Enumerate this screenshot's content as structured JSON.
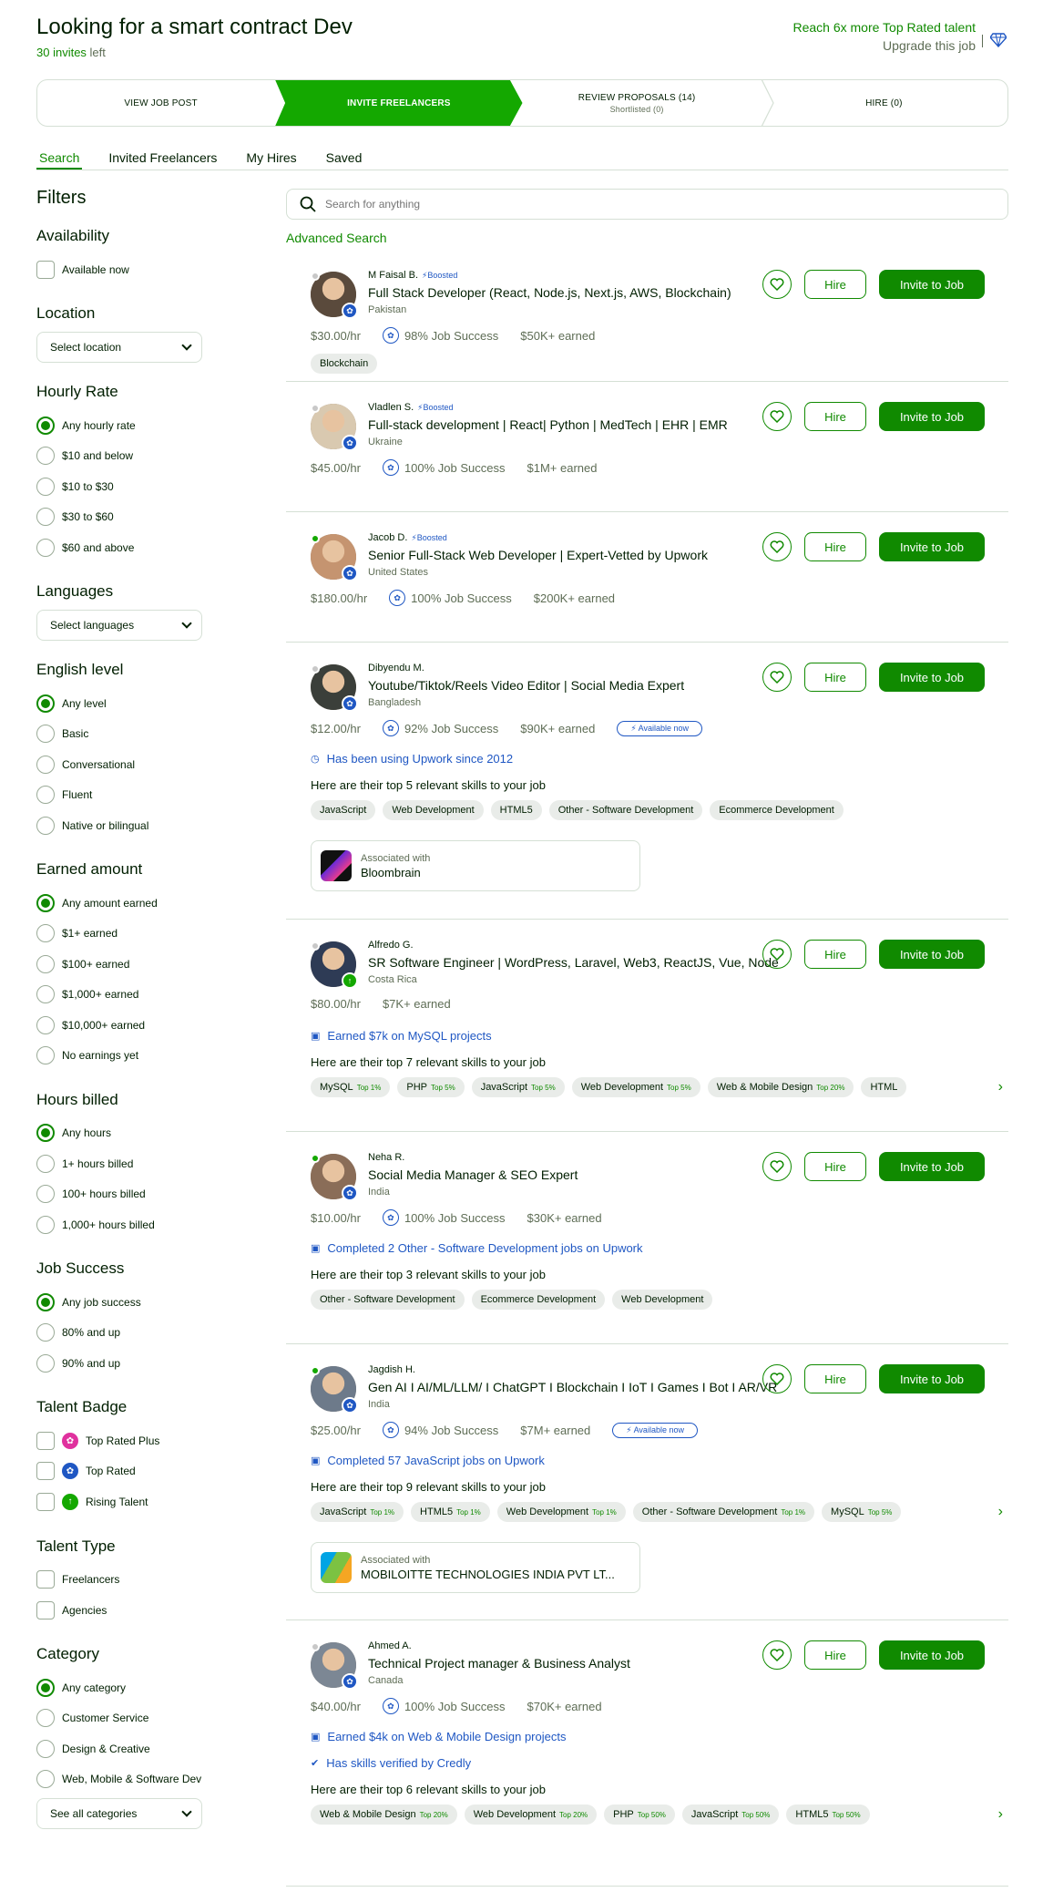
{
  "header": {
    "title": "Looking for a smart contract Dev",
    "invites_count": "30 invites",
    "invites_suffix": " left",
    "reach_text": "Reach 6x more Top Rated talent",
    "upgrade_text": "Upgrade this job"
  },
  "steps": [
    {
      "label": "VIEW JOB POST",
      "sub": ""
    },
    {
      "label": "INVITE FREELANCERS",
      "sub": ""
    },
    {
      "label": "REVIEW PROPOSALS (14)",
      "sub": "Shortlisted (0)"
    },
    {
      "label": "HIRE (0)",
      "sub": ""
    }
  ],
  "tabs": [
    "Search",
    "Invited Freelancers",
    "My Hires",
    "Saved"
  ],
  "filters": {
    "title": "Filters",
    "availability": {
      "title": "Availability",
      "options": [
        "Available now"
      ]
    },
    "location": {
      "title": "Location",
      "placeholder": "Select location"
    },
    "hourly_rate": {
      "title": "Hourly Rate",
      "options": [
        "Any hourly rate",
        "$10 and below",
        "$10 to $30",
        "$30 to $60",
        "$60 and above"
      ],
      "selected": 0
    },
    "languages": {
      "title": "Languages",
      "placeholder": "Select languages"
    },
    "english": {
      "title": "English level",
      "options": [
        "Any level",
        "Basic",
        "Conversational",
        "Fluent",
        "Native or bilingual"
      ],
      "selected": 0
    },
    "earned": {
      "title": "Earned amount",
      "options": [
        "Any amount earned",
        "$1+ earned",
        "$100+ earned",
        "$1,000+ earned",
        "$10,000+ earned",
        "No earnings yet"
      ],
      "selected": 0
    },
    "hours": {
      "title": "Hours billed",
      "options": [
        "Any hours",
        "1+ hours billed",
        "100+ hours billed",
        "1,000+ hours billed"
      ],
      "selected": 0
    },
    "job_success": {
      "title": "Job Success",
      "options": [
        "Any job success",
        "80% and up",
        "90% and up"
      ],
      "selected": 0
    },
    "badge": {
      "title": "Talent Badge",
      "options": [
        "Top Rated Plus",
        "Top Rated",
        "Rising Talent"
      ]
    },
    "type": {
      "title": "Talent Type",
      "options": [
        "Freelancers",
        "Agencies"
      ]
    },
    "category": {
      "title": "Category",
      "options": [
        "Any category",
        "Customer Service",
        "Design & Creative",
        "Web, Mobile & Software Dev"
      ],
      "selected": 0,
      "see_all": "See all categories"
    }
  },
  "search": {
    "placeholder": "Search for anything",
    "advanced": "Advanced Search"
  },
  "actions": {
    "hire": "Hire",
    "invite": "Invite to Job"
  },
  "boosted": "Boosted",
  "available_now": "Available now",
  "associated_with": "Associated with",
  "colors": {
    "primary": "#108a00",
    "brand_green": "#14a800",
    "link_blue": "#1f57c3",
    "muted": "#5e6d55"
  },
  "freelancers": [
    {
      "name": "M Faisal B.",
      "boosted": true,
      "headline": "Full Stack Developer (React, Node.js, Next.js, AWS, Blockchain)",
      "country": "Pakistan",
      "rate": "$30.00/hr",
      "job_success": "98% Job Success",
      "earned": "$50K+ earned",
      "badge": "top-rated",
      "online": false,
      "skills": [
        {
          "name": "Blockchain"
        }
      ]
    },
    {
      "name": "Vladlen S.",
      "boosted": true,
      "headline": "Full-stack development | React| Python | MedTech | EHR | EMR",
      "country": "Ukraine",
      "rate": "$45.00/hr",
      "job_success": "100% Job Success",
      "earned": "$1M+ earned",
      "badge": "top-rated",
      "online": false
    },
    {
      "name": "Jacob D.",
      "boosted": true,
      "headline": "Senior Full-Stack Web Developer | Expert-Vetted by Upwork",
      "country": "United States",
      "rate": "$180.00/hr",
      "job_success": "100% Job Success",
      "earned": "$200K+ earned",
      "badge": "top-rated",
      "online": true
    },
    {
      "name": "Dibyendu M.",
      "boosted": false,
      "headline": "Youtube/Tiktok/Reels Video Editor | Social Media Expert",
      "country": "Bangladesh",
      "rate": "$12.00/hr",
      "job_success": "92% Job Success",
      "earned": "$90K+ earned",
      "badge": "top-rated",
      "online": false,
      "available": true,
      "note": "Has been using Upwork since 2012",
      "relevant": "Here are their top 5 relevant skills to your job",
      "skills": [
        {
          "name": "JavaScript"
        },
        {
          "name": "Web Development"
        },
        {
          "name": "HTML5"
        },
        {
          "name": "Other - Software Development"
        },
        {
          "name": "Ecommerce Development"
        }
      ],
      "association": "Bloombrain"
    },
    {
      "name": "Alfredo G.",
      "boosted": false,
      "headline": "SR Software Engineer | WordPress, Laravel, Web3, ReactJS, Vue, Node",
      "country": "Costa Rica",
      "rate": "$80.00/hr",
      "job_success": "",
      "earned": "$7K+ earned",
      "badge": "rising",
      "online": false,
      "note": "Earned $7k on MySQL projects",
      "relevant": "Here are their top 7 relevant skills to your job",
      "skills": [
        {
          "name": "MySQL",
          "top": "Top 1%"
        },
        {
          "name": "PHP",
          "top": "Top 5%"
        },
        {
          "name": "JavaScript",
          "top": "Top 5%"
        },
        {
          "name": "Web Development",
          "top": "Top 5%"
        },
        {
          "name": "Web & Mobile Design",
          "top": "Top 20%"
        },
        {
          "name": "HTML"
        }
      ]
    },
    {
      "name": "Neha R.",
      "boosted": false,
      "headline": "Social Media Manager & SEO Expert",
      "country": "India",
      "rate": "$10.00/hr",
      "job_success": "100% Job Success",
      "earned": "$30K+ earned",
      "badge": "top-rated",
      "online": true,
      "note": "Completed 2 Other - Software Development jobs on Upwork",
      "relevant": "Here are their top 3 relevant skills to your job",
      "skills": [
        {
          "name": "Other - Software Development"
        },
        {
          "name": "Ecommerce Development"
        },
        {
          "name": "Web Development"
        }
      ]
    },
    {
      "name": "Jagdish H.",
      "boosted": false,
      "headline": "Gen AI I AI/ML/LLM/ I ChatGPT I Blockchain I IoT I Games I Bot I AR/VR",
      "country": "India",
      "rate": "$25.00/hr",
      "job_success": "94% Job Success",
      "earned": "$7M+ earned",
      "badge": "top-rated",
      "online": true,
      "available": true,
      "note": "Completed 57 JavaScript jobs on Upwork",
      "relevant": "Here are their top 9 relevant skills to your job",
      "skills": [
        {
          "name": "JavaScript",
          "top": "Top 1%"
        },
        {
          "name": "HTML5",
          "top": "Top 1%"
        },
        {
          "name": "Web Development",
          "top": "Top 1%"
        },
        {
          "name": "Other - Software Development",
          "top": "Top 1%"
        },
        {
          "name": "MySQL",
          "top": "Top 5%"
        }
      ],
      "association": "MOBILOITTE TECHNOLOGIES INDIA PVT LT..."
    },
    {
      "name": "Ahmed A.",
      "boosted": false,
      "headline": "Technical Project manager & Business Analyst",
      "country": "Canada",
      "rate": "$40.00/hr",
      "job_success": "100% Job Success",
      "earned": "$70K+ earned",
      "badge": "top-rated",
      "online": false,
      "note": "Earned $4k on Web & Mobile Design projects",
      "note2": "Has skills verified by Credly",
      "relevant": "Here are their top 6 relevant skills to your job",
      "skills": [
        {
          "name": "Web & Mobile Design",
          "top": "Top 20%"
        },
        {
          "name": "Web Development",
          "top": "Top 20%"
        },
        {
          "name": "PHP",
          "top": "Top 50%"
        },
        {
          "name": "JavaScript",
          "top": "Top 50%"
        },
        {
          "name": "HTML5",
          "top": "Top 50%"
        }
      ]
    }
  ]
}
